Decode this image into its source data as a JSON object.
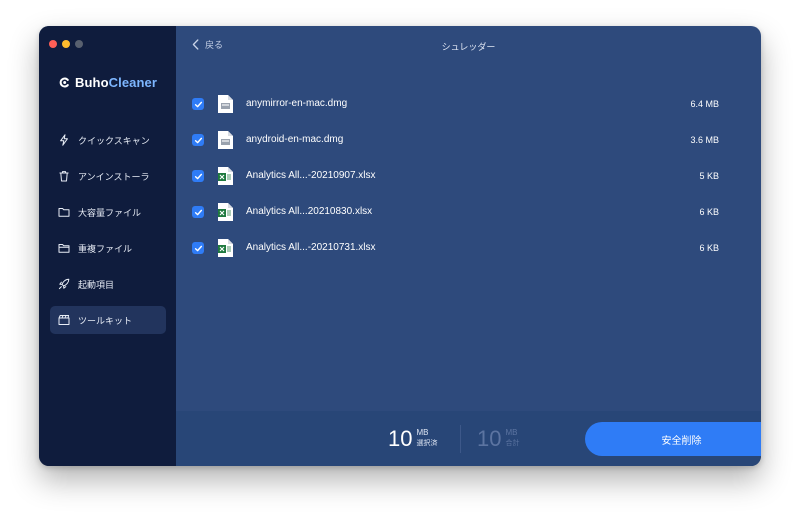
{
  "app": {
    "brand_prefix": "Buho",
    "brand_suffix": "Cleaner"
  },
  "sidebar": {
    "items": [
      {
        "label": "クイックスキャン",
        "icon": "lightning-icon"
      },
      {
        "label": "アンインストーラ",
        "icon": "trash-icon"
      },
      {
        "label": "大容量ファイル",
        "icon": "folder-icon"
      },
      {
        "label": "重複ファイル",
        "icon": "duplicate-folder-icon"
      },
      {
        "label": "起動項目",
        "icon": "rocket-icon"
      },
      {
        "label": "ツールキット",
        "icon": "toolkit-icon",
        "active": true
      }
    ]
  },
  "header": {
    "back_label": "戻る",
    "title": "シュレッダー"
  },
  "files": [
    {
      "name": "anymirror-en-mac.dmg",
      "size": "6.4 MB",
      "type": "dmg",
      "checked": true
    },
    {
      "name": "anydroid-en-mac.dmg",
      "size": "3.6 MB",
      "type": "dmg",
      "checked": true
    },
    {
      "name": "Analytics All...-20210907.xlsx",
      "size": "5 KB",
      "type": "xlsx",
      "checked": true
    },
    {
      "name": "Analytics All...20210830.xlsx",
      "size": "6 KB",
      "type": "xlsx",
      "checked": true
    },
    {
      "name": "Analytics All...-20210731.xlsx",
      "size": "6 KB",
      "type": "xlsx",
      "checked": true
    }
  ],
  "footer": {
    "selected": {
      "value": "10",
      "unit": "MB",
      "label": "選択済"
    },
    "total": {
      "value": "10",
      "unit": "MB",
      "label": "合計"
    },
    "delete_label": "安全削除"
  },
  "colors": {
    "accent": "#2f7cf6",
    "sidebar_bg": "#0f1c3d",
    "main_bg": "#2e4a7c",
    "excel_green": "#1f7a3f"
  }
}
